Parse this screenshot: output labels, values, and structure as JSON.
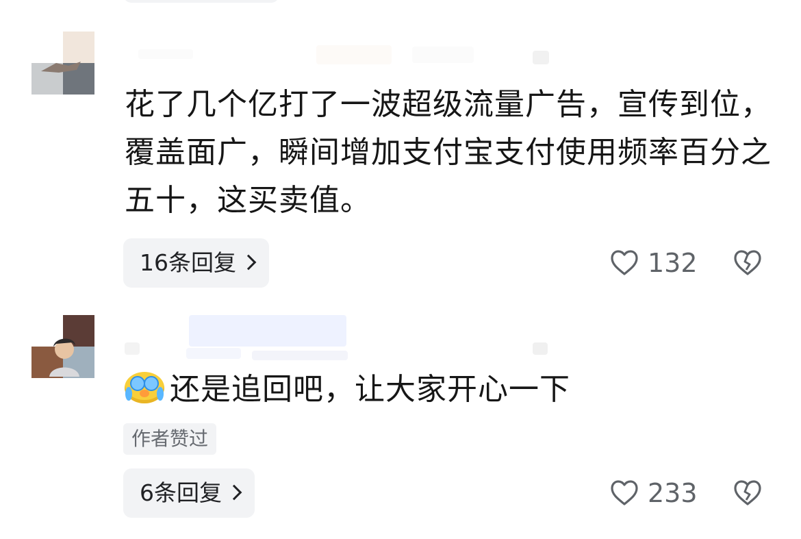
{
  "comments": [
    {
      "text": "花了几个亿打了一波超级流量广告，宣传到位，覆盖面广，瞬间增加支付宝支付使用频率百分之五十，这买卖值。",
      "replies_label": "16条回复",
      "like_count": "132",
      "emoji": ""
    },
    {
      "text": "还是追回吧，让大家开心一下",
      "author_badge": "作者赞过",
      "replies_label": "6条回复",
      "like_count": "233",
      "emoji": "crying-face"
    }
  ],
  "icons": {
    "like": "heart-outline-icon",
    "dislike": "broken-heart-icon",
    "more": "chevron-right-icon"
  },
  "colors": {
    "text": "#161616",
    "secondary": "#5f6368",
    "pill_bg": "#f2f3f5",
    "icon_stroke": "#5f6368"
  }
}
